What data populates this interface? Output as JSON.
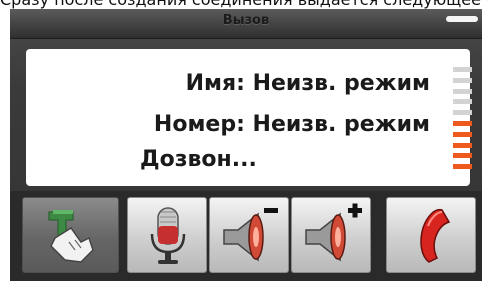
{
  "caption": "Сразу после создания соединения выдается следующее окно:",
  "window": {
    "title": "Вызов"
  },
  "call": {
    "name_line": "Имя: Неизв. режим",
    "number_line": "Номер: Неизв. режим",
    "status_line": "Дозвон..."
  },
  "signal_meter": {
    "segments_total": 10,
    "segments_active": 5,
    "active_color": "#ee5a1e",
    "inactive_color": "#d3d3d3"
  },
  "toolbar": {
    "buttons": [
      {
        "icon": "hold-transfer-hand-icon"
      },
      {
        "icon": "microphone-icon"
      },
      {
        "icon": "volume-down-icon"
      },
      {
        "icon": "volume-up-icon"
      },
      {
        "icon": "hang-up-phone-icon"
      }
    ]
  }
}
